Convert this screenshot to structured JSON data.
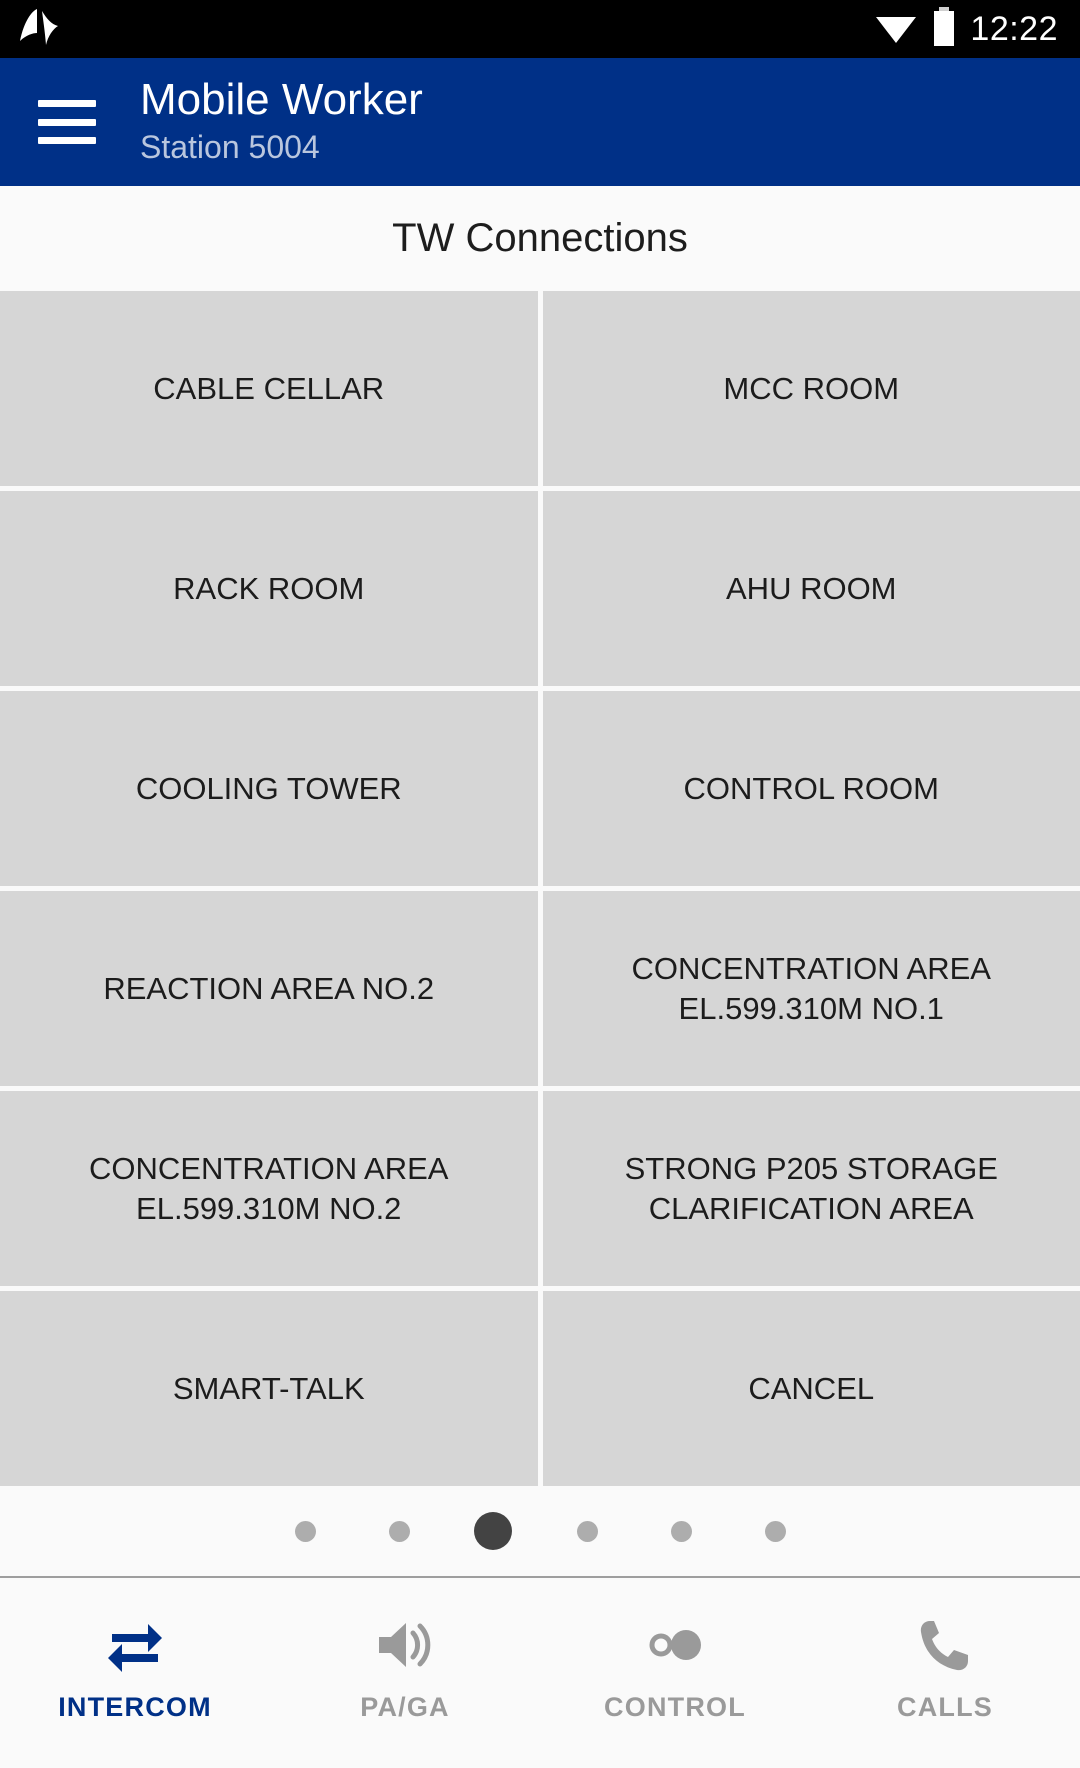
{
  "statusbar": {
    "app_icon": "av-logo-icon",
    "wifi_icon": "wifi-icon",
    "battery_icon": "battery-icon",
    "time": "12:22"
  },
  "appbar": {
    "menu_icon": "hamburger-menu-icon",
    "title": "Mobile Worker",
    "subtitle": "Station 5004",
    "background_color": "#003087"
  },
  "page": {
    "title": "TW Connections"
  },
  "grid": {
    "button_color": "#d6d6d6",
    "buttons": [
      {
        "label": "CABLE CELLAR",
        "lines": [
          "CABLE CELLAR"
        ]
      },
      {
        "label": "MCC ROOM",
        "lines": [
          "MCC ROOM"
        ]
      },
      {
        "label": "RACK ROOM",
        "lines": [
          "RACK ROOM"
        ]
      },
      {
        "label": "AHU ROOM",
        "lines": [
          "AHU ROOM"
        ]
      },
      {
        "label": "COOLING TOWER",
        "lines": [
          "COOLING TOWER"
        ]
      },
      {
        "label": "CONTROL ROOM",
        "lines": [
          "CONTROL ROOM"
        ]
      },
      {
        "label": "REACTION AREA NO.2",
        "lines": [
          "REACTION AREA NO.2"
        ]
      },
      {
        "label": "CONCENTRATION AREA EL.599.310M NO.1",
        "lines": [
          "CONCENTRATION AREA",
          "EL.599.310M NO.1"
        ]
      },
      {
        "label": "CONCENTRATION AREA EL.599.310M NO.2",
        "lines": [
          "CONCENTRATION AREA",
          "EL.599.310M NO.2"
        ]
      },
      {
        "label": "STRONG P205 STORAGE CLARIFICATION AREA",
        "lines": [
          "STRONG P205 STORAGE",
          "CLARIFICATION AREA"
        ]
      },
      {
        "label": "SMART-TALK",
        "lines": [
          "SMART-TALK"
        ]
      },
      {
        "label": "CANCEL",
        "lines": [
          "CANCEL"
        ]
      }
    ]
  },
  "pager": {
    "total": 6,
    "active_index": 2,
    "inactive_color": "#adadad",
    "active_color": "#434343"
  },
  "bottomnav": {
    "active_color": "#003087",
    "inactive_color": "#9a9a9a",
    "items": [
      {
        "label": "INTERCOM",
        "icon": "intercom-arrows-icon",
        "active": true
      },
      {
        "label": "PA/GA",
        "icon": "speaker-icon",
        "active": false
      },
      {
        "label": "CONTROL",
        "icon": "toggle-control-icon",
        "active": false
      },
      {
        "label": "CALLS",
        "icon": "phone-icon",
        "active": false
      }
    ]
  }
}
